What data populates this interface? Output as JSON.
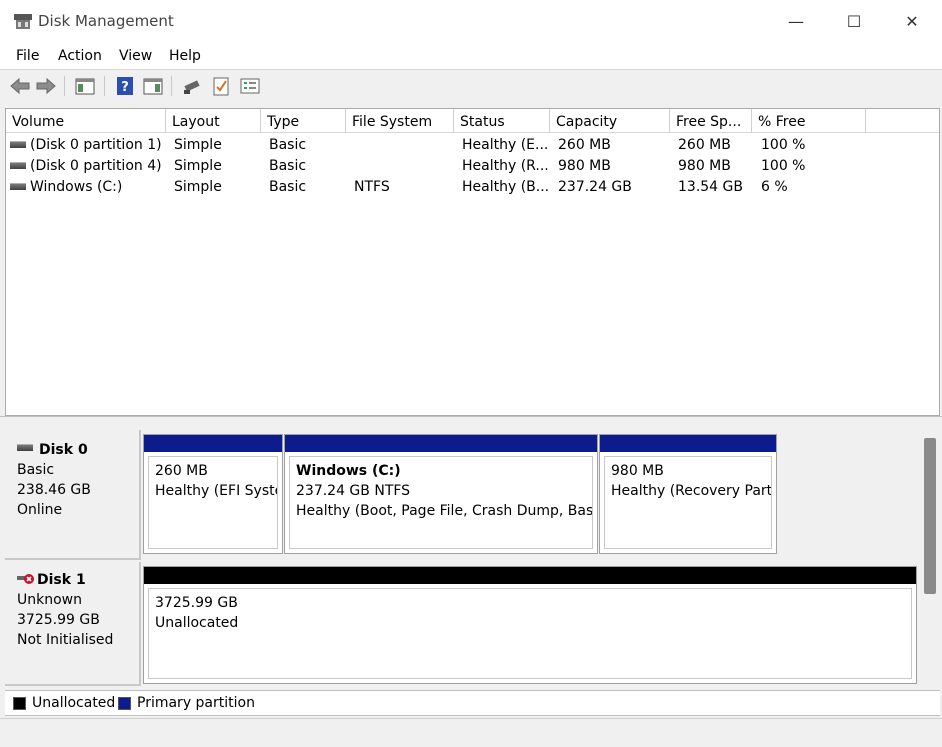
{
  "window": {
    "title": "Disk Management",
    "minimize_glyph": "—",
    "maximize_glyph": "☐",
    "close_glyph": "✕"
  },
  "menu": [
    "File",
    "Action",
    "View",
    "Help"
  ],
  "toolbar": {
    "icons": [
      "back-arrow-icon",
      "forward-arrow-icon",
      "show-hide-console-tree-icon",
      "help-icon",
      "show-hide-action-pane-icon",
      "connect-icon",
      "checklist-icon",
      "properties-icon"
    ]
  },
  "volume_list": {
    "columns": [
      "Volume",
      "Layout",
      "Type",
      "File System",
      "Status",
      "Capacity",
      "Free Sp...",
      "% Free"
    ],
    "rows": [
      {
        "volume": "(Disk 0 partition 1)",
        "layout": "Simple",
        "type": "Basic",
        "fs": "",
        "status": "Healthy (E...",
        "capacity": "260 MB",
        "free": "260 MB",
        "pct": "100 %"
      },
      {
        "volume": "(Disk 0 partition 4)",
        "layout": "Simple",
        "type": "Basic",
        "fs": "",
        "status": "Healthy (R...",
        "capacity": "980 MB",
        "free": "980 MB",
        "pct": "100 %"
      },
      {
        "volume": "Windows (C:)",
        "layout": "Simple",
        "type": "Basic",
        "fs": "NTFS",
        "status": "Healthy (B...",
        "capacity": "237.24 GB",
        "free": "13.54 GB",
        "pct": "6 %"
      }
    ]
  },
  "disks": [
    {
      "name": "Disk 0",
      "kind": "Basic",
      "size": "238.46 GB",
      "state": "Online",
      "partitions": [
        {
          "line1": "",
          "line2": "260 MB",
          "line3": "Healthy (EFI System Partition)",
          "bar_color": "#0c1c8c"
        },
        {
          "line1": "Windows  (C:)",
          "line2": "237.24 GB NTFS",
          "line3": "Healthy (Boot, Page File, Crash Dump, Basic Data Partition)",
          "bar_color": "#0c1c8c"
        },
        {
          "line1": "",
          "line2": "980 MB",
          "line3": "Healthy (Recovery Partition)",
          "bar_color": "#0c1c8c"
        }
      ]
    },
    {
      "name": "Disk 1",
      "kind": "Unknown",
      "size": "3725.99 GB",
      "state": "Not Initialised",
      "partitions": [
        {
          "line1": "",
          "line2": "3725.99 GB",
          "line3": "Unallocated",
          "bar_color": "#000000"
        }
      ]
    }
  ],
  "legend": [
    {
      "label": "Unallocated",
      "color": "#000000"
    },
    {
      "label": "Primary partition",
      "color": "#0c1c8c"
    }
  ]
}
